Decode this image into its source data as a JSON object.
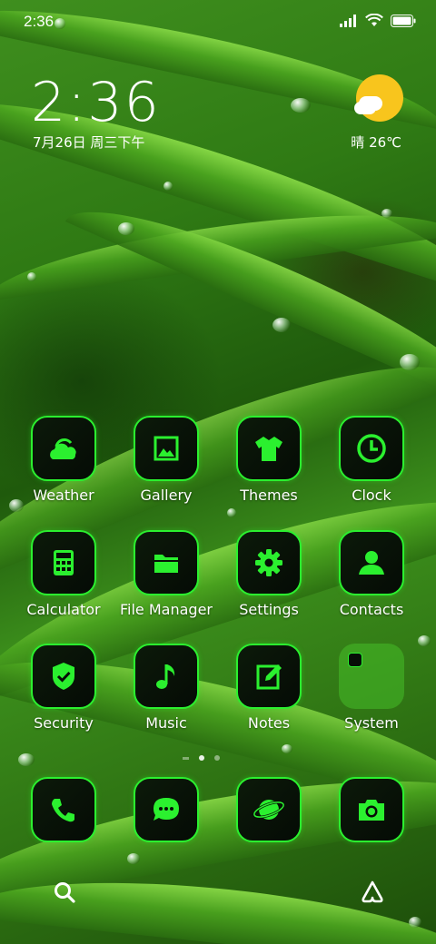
{
  "status_bar": {
    "time": "2:36"
  },
  "clock_widget": {
    "time": "2:36",
    "date": "7月26日 周三下午",
    "weather": "晴 26℃"
  },
  "apps": [
    {
      "label": "Weather",
      "icon": "weather-icon"
    },
    {
      "label": "Gallery",
      "icon": "gallery-icon"
    },
    {
      "label": "Themes",
      "icon": "themes-icon"
    },
    {
      "label": "Clock",
      "icon": "clock-icon"
    },
    {
      "label": "Calculator",
      "icon": "calculator-icon"
    },
    {
      "label": "File Manager",
      "icon": "folder-icon"
    },
    {
      "label": "Settings",
      "icon": "gear-icon"
    },
    {
      "label": "Contacts",
      "icon": "contacts-icon"
    },
    {
      "label": "Security",
      "icon": "shield-icon"
    },
    {
      "label": "Music",
      "icon": "music-icon"
    },
    {
      "label": "Notes",
      "icon": "notes-icon"
    },
    {
      "label": "System",
      "icon": "folder-icon"
    }
  ],
  "dock": [
    {
      "icon": "phone-icon"
    },
    {
      "icon": "messages-icon"
    },
    {
      "icon": "browser-icon"
    },
    {
      "icon": "camera-icon"
    }
  ],
  "colors": {
    "icon_green": "#2bf02f",
    "icon_bg": "#070e07",
    "sun": "#f8c51d"
  }
}
